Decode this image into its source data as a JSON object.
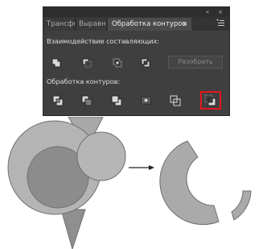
{
  "panel": {
    "topbar": {
      "collapse_glyph": "«",
      "close_glyph": "×"
    },
    "tabs": [
      {
        "label": "Трансфо",
        "active": false
      },
      {
        "label": "Выравн",
        "active": false
      },
      {
        "label": "Обработка контуров",
        "active": true,
        "close_glyph": "×"
      }
    ],
    "menu_icon": "panel-menu-icon",
    "shape_modes": {
      "label": "Взаимодействие составляющих:",
      "buttons": [
        {
          "name": "unite",
          "icon": "unite-icon"
        },
        {
          "name": "minus-front",
          "icon": "minus-front-icon"
        },
        {
          "name": "intersect",
          "icon": "intersect-icon"
        },
        {
          "name": "exclude",
          "icon": "exclude-icon"
        }
      ],
      "expand_label": "Разобрать"
    },
    "pathfinders": {
      "label": "Обработка контуров:",
      "buttons": [
        {
          "name": "divide",
          "icon": "divide-icon",
          "selected": false
        },
        {
          "name": "trim",
          "icon": "trim-icon",
          "selected": false
        },
        {
          "name": "merge",
          "icon": "merge-icon",
          "selected": false
        },
        {
          "name": "crop",
          "icon": "crop-icon",
          "selected": false
        },
        {
          "name": "outline",
          "icon": "outline-icon",
          "selected": false
        },
        {
          "name": "minus-back",
          "icon": "minus-back-icon",
          "selected": true
        }
      ]
    }
  },
  "illustration": {
    "before_icon": "overlapping-shapes-icon",
    "arrow_icon": "right-arrow-icon",
    "after_icon": "result-shape-icon"
  },
  "colors": {
    "panel_bg": "#3f3f3f",
    "highlight": "#e0181f",
    "shape_light": "#b4b4b4",
    "shape_dark": "#8f8f8f",
    "shape_outline": "#6f6f6f"
  }
}
